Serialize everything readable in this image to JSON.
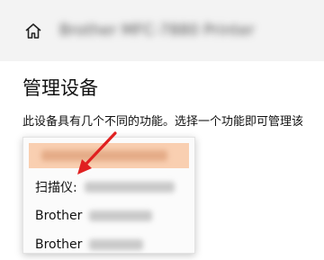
{
  "page": {
    "title": "管理设备",
    "description": "此设备具有几个不同的功能。选择一个功能即可管理该",
    "device_name": "Brother MFC-7880 Printer"
  },
  "dropdown": {
    "options": [
      {
        "label": ""
      },
      {
        "label": "扫描仪:"
      },
      {
        "label": "Brother"
      },
      {
        "label": "Brother"
      }
    ]
  },
  "icons": {
    "home": "home-icon",
    "annotation": "red-arrow-icon"
  },
  "colors": {
    "highlight": "#f9cfb1",
    "arrow": "#e02020"
  }
}
